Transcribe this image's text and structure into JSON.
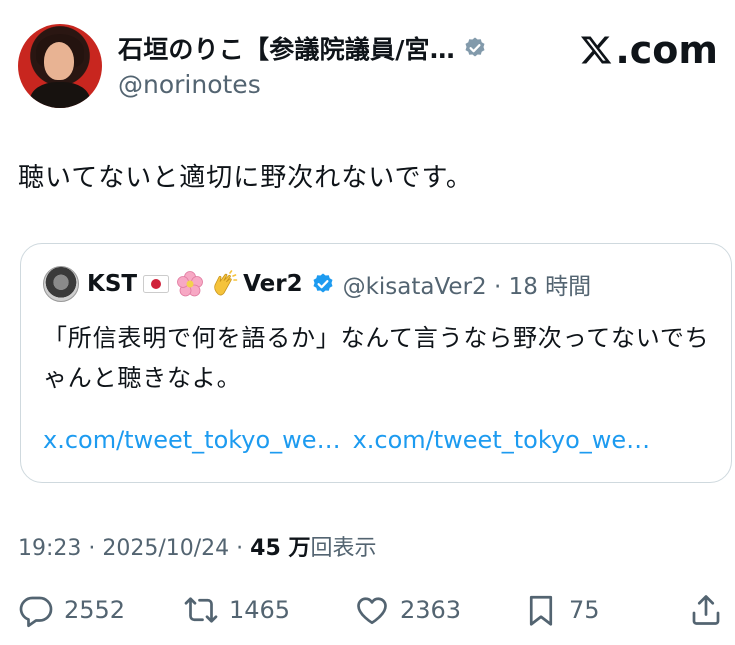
{
  "author": {
    "display_name": "石垣のりこ【参議院議員/宮…",
    "handle": "@norinotes"
  },
  "brand": {
    "logo_text": ".com"
  },
  "tweet": {
    "text": "聴いてないと適切に野次れないです。"
  },
  "quote": {
    "name_prefix": "KST",
    "name_suffix": "Ver2",
    "handle_time": "@kisataVer2 · 18 時間",
    "text": "「所信表明で何を語るか」なんて言うなら野次ってないでちゃんと聴きなよ。",
    "links": [
      "x.com/tweet_tokyo_we…",
      "x.com/tweet_tokyo_we…"
    ]
  },
  "meta": {
    "time_date": "19:23 · 2025/10/24 · ",
    "views_number": "45 万",
    "views_label": "回表示"
  },
  "actions": {
    "replies": "2552",
    "reposts": "1465",
    "likes": "2363",
    "bookmarks": "75"
  },
  "colors": {
    "link": "#1d9bf0",
    "verified_blue": "#1d9bf0",
    "verified_gray": "#829aab",
    "secondary_text": "#536471"
  }
}
